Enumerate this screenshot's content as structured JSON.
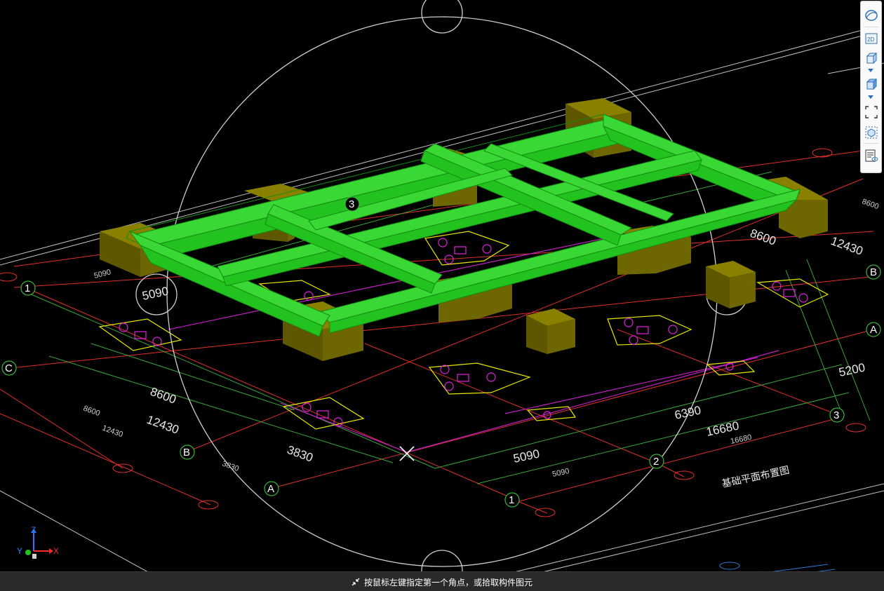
{
  "toolbar": {
    "buttons": [
      {
        "name": "dynamic-orbit-button",
        "icon": "orbit-icon"
      },
      {
        "name": "2d-view-button",
        "icon": "2d-icon",
        "label": "2D"
      },
      {
        "name": "3d-view-button",
        "icon": "cube-icon"
      },
      {
        "name": "view-direction-button",
        "icon": "cube-solid-icon"
      },
      {
        "name": "zoom-extents-button",
        "icon": "frame-icon"
      },
      {
        "name": "component-display-button",
        "icon": "component-icon"
      },
      {
        "name": "layer-display-button",
        "icon": "list-eye-icon"
      }
    ]
  },
  "dimensions": {
    "top_left_5090": "5090",
    "top_left_5090_small": "5090",
    "left_5090": "5090",
    "left_8600": "8600",
    "left_12430": "12430",
    "left_3830": "3830",
    "left_8600_small": "8600",
    "left_12430_small": "12430",
    "left_3830_small": "3830",
    "bottom_5090": "5090",
    "bottom_5090_small": "5090",
    "bottom_6390": "6390",
    "bottom_16680": "16680",
    "bottom_16680_small": "16680",
    "right_8600": "8600",
    "right_12430": "12430",
    "right_5200": "5200",
    "right_8600_small": "8600"
  },
  "axes": {
    "row_c_left": "C",
    "row_b_left": "B",
    "row_a_left": "A",
    "row_b_right": "B",
    "row_a_right": "A",
    "col_1_left": "1",
    "col_1_bottom": "1",
    "col_2_bottom": "2",
    "col_3_right": "3",
    "col_3_top": "3"
  },
  "triad": {
    "z": "Z",
    "y": "Y",
    "x": "X"
  },
  "drawing_title": "基础平面布置图",
  "status": {
    "icon": "pick-cursor-icon",
    "text": "按鼠标左键指定第一个角点，或拾取构件图元"
  },
  "colors": {
    "beam": "#22c21f",
    "beam_top": "#3ad835",
    "pile_cap": "#6e6600",
    "grid_red": "#e0302a",
    "grid_green": "#3aa63a",
    "magenta": "#c21fc2",
    "yellow": "#e6e600",
    "orbit": "#cfcfcf"
  }
}
